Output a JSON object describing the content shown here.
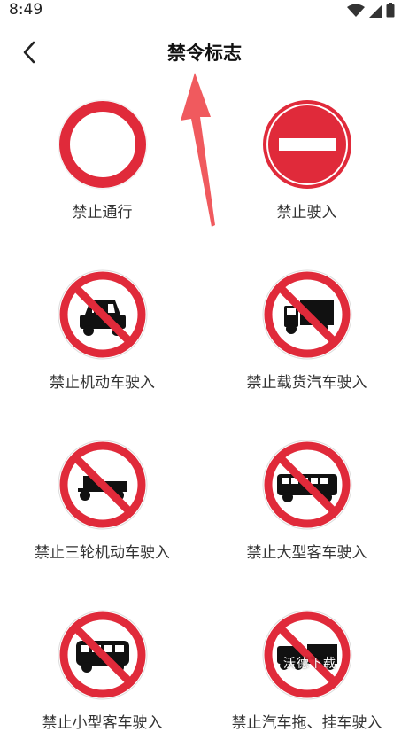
{
  "status_bar": {
    "time": "8:49"
  },
  "header": {
    "title": "禁令标志",
    "back_icon": "chevron-left-icon"
  },
  "colors": {
    "sign_red": "#e02a3a",
    "accent_arrow": "#f05a5e"
  },
  "signs": [
    {
      "label": "禁止通行",
      "type": "no-entry-circle"
    },
    {
      "label": "禁止驶入",
      "type": "no-entry-bar"
    },
    {
      "label": "禁止机动车驶入",
      "type": "no-car"
    },
    {
      "label": "禁止载货汽车驶入",
      "type": "no-truck"
    },
    {
      "label": "禁止三轮机动车驶入",
      "type": "no-tricycle"
    },
    {
      "label": "禁止大型客车驶入",
      "type": "no-bus"
    },
    {
      "label": "禁止小型客车驶入",
      "type": "no-van"
    },
    {
      "label": "禁止汽车拖、挂车驶入",
      "type": "no-trailer"
    }
  ],
  "watermark": {
    "text": "沃德下载"
  }
}
